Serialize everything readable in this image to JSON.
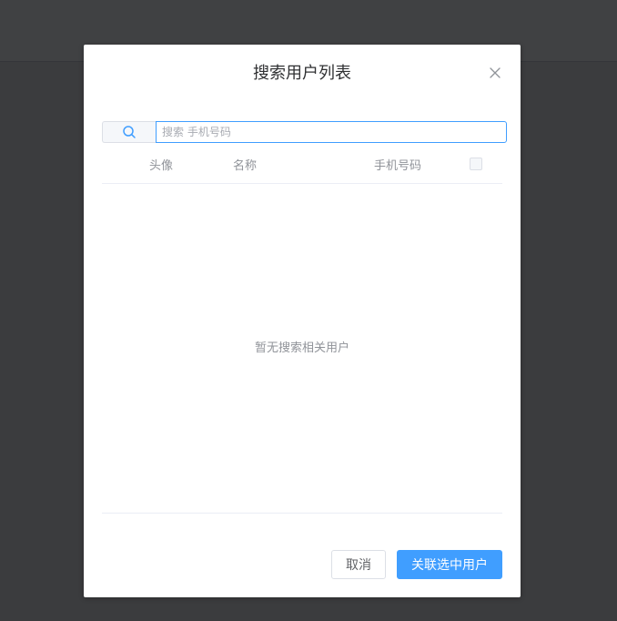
{
  "dialog": {
    "title": "搜索用户列表"
  },
  "search": {
    "placeholder": "搜索 手机号码",
    "value": ""
  },
  "table": {
    "columns": [
      "头像",
      "名称",
      "手机号码"
    ],
    "empty_text": "暂无搜索相关用户"
  },
  "footer": {
    "cancel_label": "取消",
    "confirm_label": "关联选中用户"
  },
  "colors": {
    "primary": "#409eff",
    "backdrop": "#3b3c3e"
  },
  "icons": {
    "search": "search-icon",
    "close": "close-icon"
  }
}
